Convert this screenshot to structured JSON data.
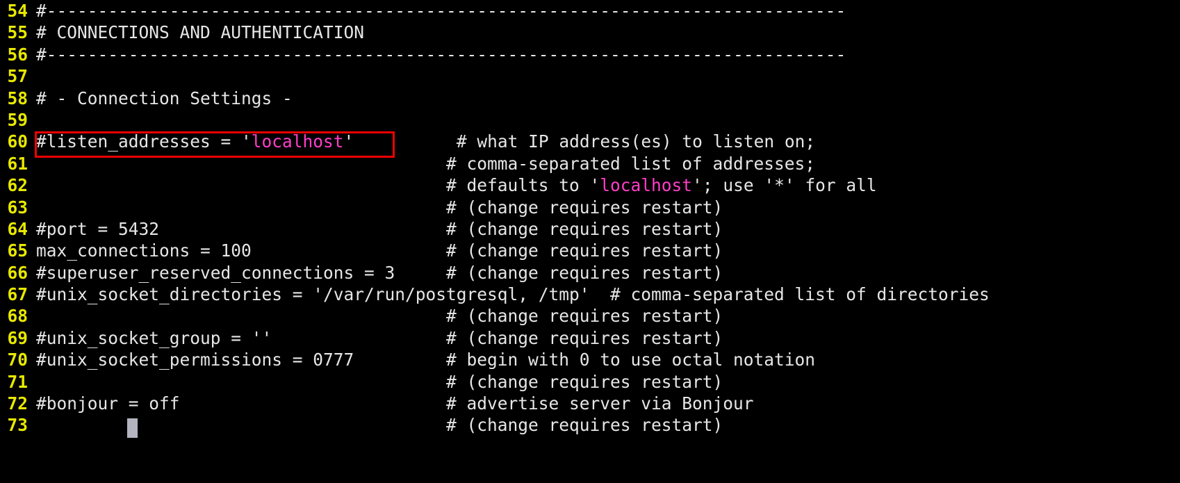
{
  "terminal": {
    "background_color": "#000000",
    "foreground_color": "#e6e6e6",
    "line_number_color": "#e8e800",
    "string_color": "#ff3ec8",
    "annotation_color": "#ee0000",
    "cursor_color": "#b4b4c0"
  },
  "lines": [
    {
      "number": "54",
      "segments": [
        {
          "text": "#------------------------------------------------------------------------------",
          "kind": "plain"
        }
      ]
    },
    {
      "number": "55",
      "segments": [
        {
          "text": "# CONNECTIONS AND AUTHENTICATION",
          "kind": "plain"
        }
      ]
    },
    {
      "number": "56",
      "segments": [
        {
          "text": "#------------------------------------------------------------------------------",
          "kind": "plain"
        }
      ]
    },
    {
      "number": "57",
      "segments": []
    },
    {
      "number": "58",
      "segments": [
        {
          "text": "# - Connection Settings -",
          "kind": "plain"
        }
      ]
    },
    {
      "number": "59",
      "segments": []
    },
    {
      "number": "60",
      "segments": [
        {
          "text": "#listen_addresses = ",
          "kind": "plain"
        },
        {
          "text": "'",
          "kind": "quote"
        },
        {
          "text": "localhost",
          "kind": "str"
        },
        {
          "text": "'",
          "kind": "quote"
        },
        {
          "text": "          # what IP address(es) to listen on;",
          "kind": "plain"
        }
      ]
    },
    {
      "number": "61",
      "segments": [
        {
          "text": "                                        # comma-separated list of addresses;",
          "kind": "plain"
        }
      ]
    },
    {
      "number": "62",
      "segments": [
        {
          "text": "                                        # defaults to ",
          "kind": "plain"
        },
        {
          "text": "'",
          "kind": "quote"
        },
        {
          "text": "localhost",
          "kind": "str"
        },
        {
          "text": "'",
          "kind": "quote"
        },
        {
          "text": "; use '*' for all",
          "kind": "plain"
        }
      ]
    },
    {
      "number": "63",
      "segments": [
        {
          "text": "                                        # (change requires restart)",
          "kind": "plain"
        }
      ]
    },
    {
      "number": "64",
      "segments": [
        {
          "text": "#port = 5432                            # (change requires restart)",
          "kind": "plain"
        }
      ]
    },
    {
      "number": "65",
      "segments": [
        {
          "text": "max_connections = 100                   # (change requires restart)",
          "kind": "plain"
        }
      ]
    },
    {
      "number": "66",
      "segments": [
        {
          "text": "#superuser_reserved_connections = 3     # (change requires restart)",
          "kind": "plain"
        }
      ]
    },
    {
      "number": "67",
      "segments": [
        {
          "text": "#unix_socket_directories = '/var/run/postgresql, /tmp'  # comma-separated list of directories",
          "kind": "plain"
        }
      ]
    },
    {
      "number": "68",
      "segments": [
        {
          "text": "                                        # (change requires restart)",
          "kind": "plain"
        }
      ]
    },
    {
      "number": "69",
      "segments": [
        {
          "text": "#unix_socket_group = ''                 # (change requires restart)",
          "kind": "plain"
        }
      ]
    },
    {
      "number": "70",
      "segments": [
        {
          "text": "#unix_socket_permissions = 0777         # begin with 0 to use octal notation",
          "kind": "plain"
        }
      ]
    },
    {
      "number": "71",
      "segments": [
        {
          "text": "                                        # (change requires restart)",
          "kind": "plain"
        }
      ]
    },
    {
      "number": "72",
      "segments": [
        {
          "text": "#bonjour = off                          # advertise server via Bonjour",
          "kind": "plain"
        }
      ]
    },
    {
      "number": "73",
      "segments": [
        {
          "text": "                                        # (change requires restart)",
          "kind": "plain"
        }
      ]
    }
  ],
  "annotation": {
    "label": "highlighted-setting",
    "target_text": "#listen_addresses = 'localhost'"
  },
  "cursor": {
    "line_number": "73",
    "column": 9
  }
}
